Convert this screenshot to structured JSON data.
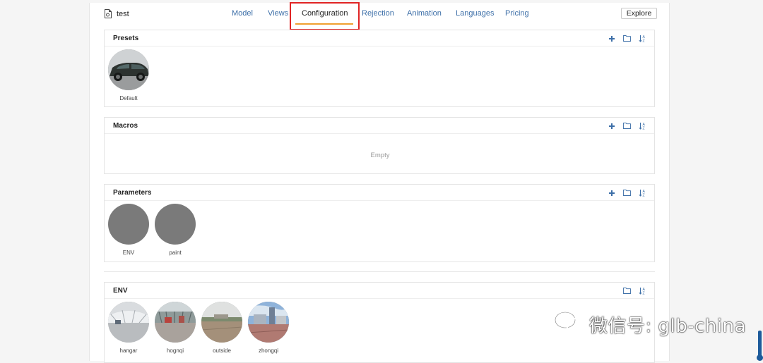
{
  "app": {
    "file_name": "test",
    "explore_label": "Explore"
  },
  "tabs": [
    {
      "label": "Model"
    },
    {
      "label": "Views"
    },
    {
      "label": "Configuration"
    },
    {
      "label": "Rejection"
    },
    {
      "label": "Animation"
    },
    {
      "label": "Languages"
    },
    {
      "label": "Pricing"
    }
  ],
  "active_tab": "Configuration",
  "panels": {
    "presets": {
      "title": "Presets",
      "items": [
        {
          "label": "Default"
        }
      ]
    },
    "macros": {
      "title": "Macros",
      "empty_text": "Empty"
    },
    "parameters": {
      "title": "Parameters",
      "items": [
        {
          "label": "ENV"
        },
        {
          "label": "paint"
        }
      ]
    },
    "env": {
      "title": "ENV",
      "items": [
        {
          "label": "hangar"
        },
        {
          "label": "hognqi"
        },
        {
          "label": "outside"
        },
        {
          "label": "zhongqi"
        }
      ]
    }
  },
  "watermark": {
    "text": "微信号: glb-china",
    "icon": "wechat-icon"
  },
  "colors": {
    "tab_link": "#3d6fa8",
    "active_underline": "#f0a030",
    "highlight_box": "#e02424",
    "tool_icon": "#3d6fa8",
    "scrollbar": "#1d5b9b"
  }
}
